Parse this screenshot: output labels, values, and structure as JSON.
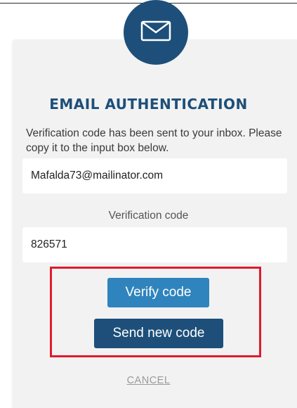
{
  "header": {
    "title": "EMAIL AUTHENTICATION",
    "icon": "envelope-icon"
  },
  "description": "Verification code has been sent to your inbox. Please copy it to the input box below.",
  "email_field": {
    "value": "Mafalda73@mailinator.com"
  },
  "code_field": {
    "label": "Verification code",
    "value": "826571"
  },
  "actions": {
    "verify_label": "Verify code",
    "send_new_label": "Send new code",
    "cancel_label": "CANCEL"
  },
  "colors": {
    "primary_dark": "#1d4f7a",
    "primary_light": "#2f84bd",
    "highlight_red": "#e01b2e",
    "card_bg": "#f2f2f2"
  }
}
